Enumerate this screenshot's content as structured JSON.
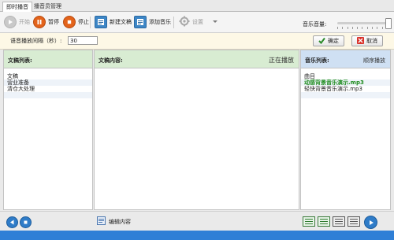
{
  "tabs": [
    "即时播音",
    "播音员管理"
  ],
  "toolbar": {
    "start": "开始",
    "pause": "暂停",
    "stop": "停止",
    "new_doc": "新建文稿",
    "add_music": "添加音乐",
    "settings": "设置",
    "volume_label": "音乐音量:"
  },
  "volume": {
    "level": 0.96
  },
  "interval": {
    "label": "语音播放间隔（秒）:",
    "value": "30",
    "confirm": "确定",
    "cancel": "取消"
  },
  "doc_list": {
    "title": "文稿列表:",
    "items": [
      "文稿",
      "营业准备",
      "清仓大处理"
    ]
  },
  "content": {
    "title": "文稿内容:",
    "status": "正在播放"
  },
  "music": {
    "title": "音乐列表:",
    "mode": "顺序播放",
    "header": "曲目",
    "items": [
      "动感背景音乐演示.mp3",
      "轻快背景音乐演示.mp3"
    ]
  },
  "bottom": {
    "edit_content": "编辑内容"
  },
  "colors": {
    "accent_orange": "#e3631b",
    "accent_blue": "#2f7fd6",
    "header_green": "#d8ecd2",
    "playing_green": "#1e8b1e"
  }
}
